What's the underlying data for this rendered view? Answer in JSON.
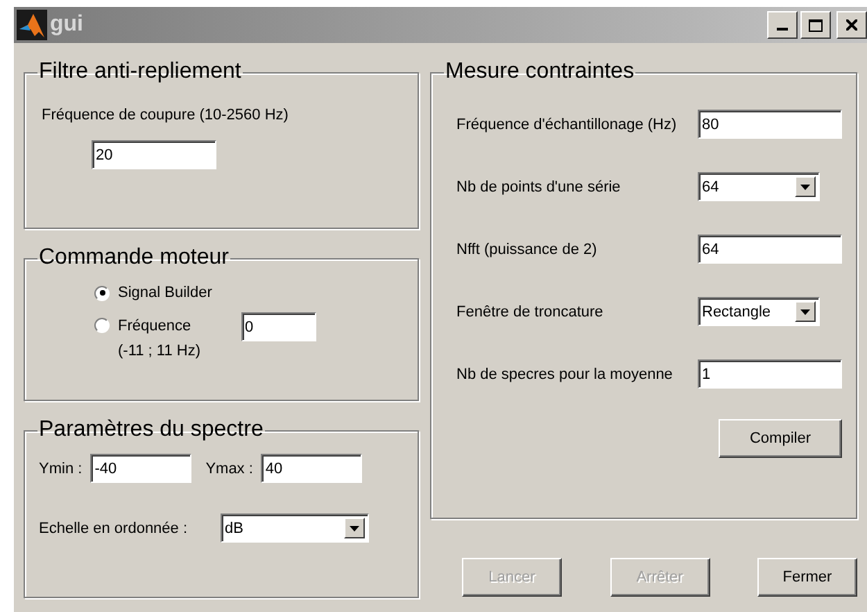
{
  "window": {
    "title": "gui"
  },
  "anti_aliasing_filter": {
    "title": "Filtre anti-repliement",
    "label": "Fréquence de coupure (10-2560 Hz)",
    "value": "20"
  },
  "motor_control": {
    "title": "Commande moteur",
    "options": [
      {
        "label": "Signal Builder",
        "selected": true
      },
      {
        "label": "Fréquence",
        "sublabel": "(-11 ; 11 Hz)",
        "value": "0",
        "selected": false
      }
    ]
  },
  "spectrum": {
    "title": "Paramètres du spectre",
    "ymin_label": "Ymin :",
    "ymin": "-40",
    "ymax_label": "Ymax :",
    "ymax": "40",
    "scale_label": "Echelle en ordonnée :",
    "scale": "dB"
  },
  "measure": {
    "title": "Mesure contraintes",
    "fields": [
      {
        "kind": "input",
        "label": "Fréquence d'échantillonage (Hz)",
        "value": "80"
      },
      {
        "kind": "select",
        "label": "Nb de points d'une série",
        "value": "64"
      },
      {
        "kind": "input",
        "label": "Nfft (puissance de 2)",
        "value": "64"
      },
      {
        "kind": "select",
        "label": "Fenêtre de troncature",
        "value": "Rectangle"
      },
      {
        "kind": "input",
        "label": "Nb de specres pour la moyenne",
        "value": "1"
      }
    ],
    "button": "Compiler"
  },
  "buttons": [
    {
      "label": "Lancer",
      "disabled": true
    },
    {
      "label": "Arrêter",
      "disabled": true
    },
    {
      "label": "Fermer",
      "disabled": false
    }
  ]
}
